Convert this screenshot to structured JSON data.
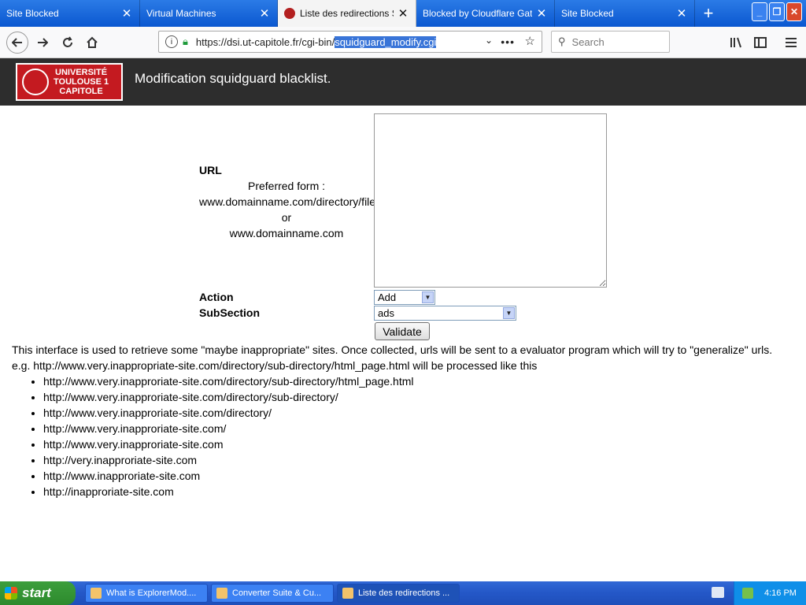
{
  "browser": {
    "tabs": [
      {
        "title": "Site Blocked",
        "active": false
      },
      {
        "title": "Virtual Machines",
        "active": false
      },
      {
        "title": "Liste des redirections SI...",
        "active": true
      },
      {
        "title": "Blocked by Cloudflare Gatew...",
        "active": false
      },
      {
        "title": "Site Blocked",
        "active": false
      }
    ],
    "url_prefix": "https://dsi.ut-capitole.fr/cgi-bin/",
    "url_selected": "squidguard_modify.cgi",
    "search_placeholder": "Search"
  },
  "header": {
    "logo_lines": [
      "UNIVERSITÉ",
      "TOULOUSE 1",
      "CAPITOLE"
    ],
    "title": "Modification squidguard blacklist."
  },
  "form": {
    "url_label": "URL",
    "preferred_line1": "Preferred form :",
    "preferred_line2": "www.domainname.com/directory/file",
    "preferred_line3": "or",
    "preferred_line4": "www.domainname.com",
    "action_label": "Action",
    "action_value": "Add",
    "subsection_label": "SubSection",
    "subsection_value": "ads",
    "validate_label": "Validate"
  },
  "description": {
    "line1": "This interface is used to retrieve some \"maybe inappropriate\" sites. Once collected, urls will be sent to a evaluator program which will try to \"generalize\" urls.",
    "line2": "e.g. http://www.very.inappropriate-site.com/directory/sub-directory/html_page.html will be processed like this",
    "examples": [
      "http://www.very.inapproriate-site.com/directory/sub-directory/html_page.html",
      "http://www.very.inapproriate-site.com/directory/sub-directory/",
      "http://www.very.inapproriate-site.com/directory/",
      "http://www.very.inapproriate-site.com/",
      "http://www.very.inapproriate-site.com",
      "http://very.inapproriate-site.com",
      "http://www.inapproriate-site.com",
      "http://inapproriate-site.com"
    ]
  },
  "taskbar": {
    "start_label": "start",
    "tasks": [
      {
        "title": "What is ExplorerMod....",
        "active": false
      },
      {
        "title": "Converter Suite & Cu...",
        "active": false
      },
      {
        "title": "Liste des redirections ...",
        "active": true
      }
    ],
    "clock": "4:16 PM"
  },
  "colors": {
    "tabbar": "#0a57d0",
    "page_header": "#2d2d2d",
    "logo_red": "#c41a20",
    "url_selection": "#3874d8"
  }
}
